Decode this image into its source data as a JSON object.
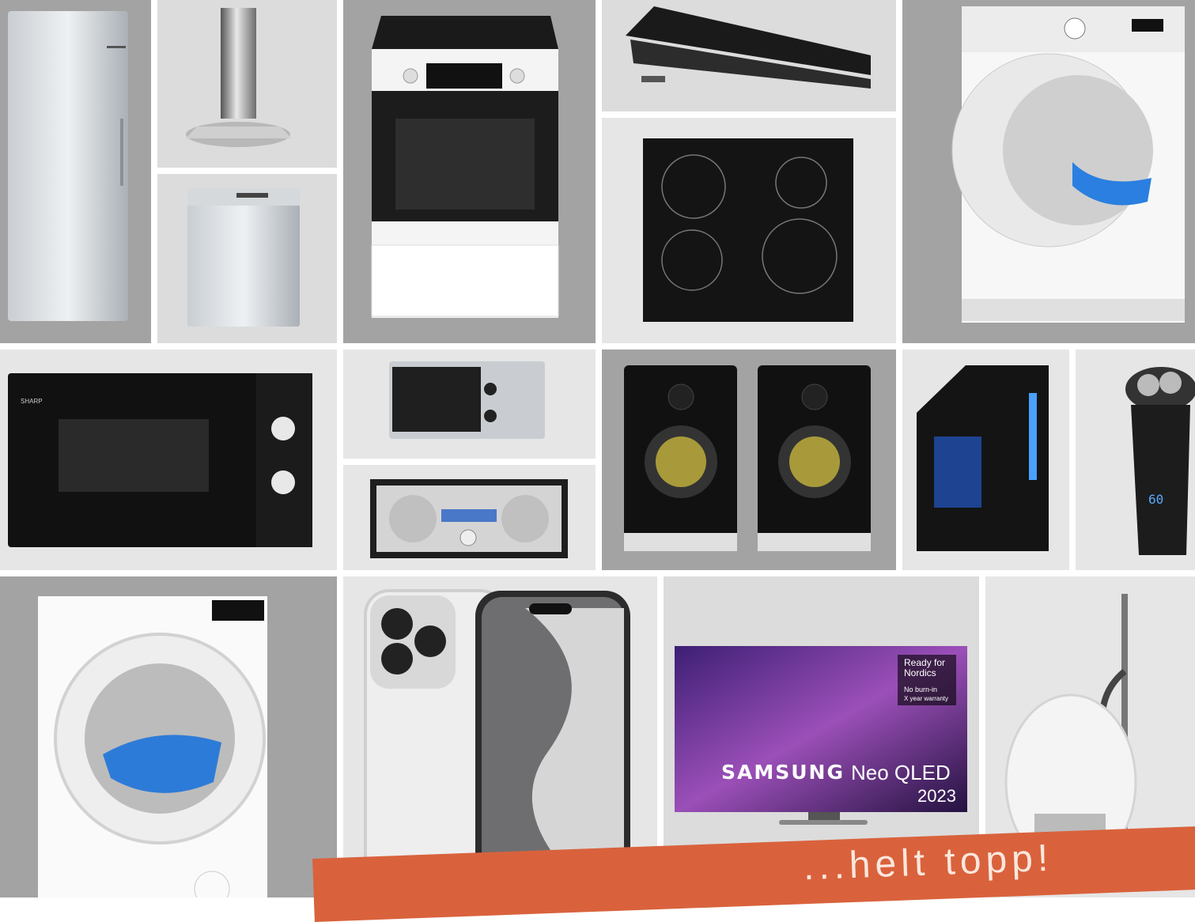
{
  "products": [
    {
      "id": "fridge",
      "label": ""
    },
    {
      "id": "range-hood",
      "label": ""
    },
    {
      "id": "dishwasher",
      "label": ""
    },
    {
      "id": "electric-cooker",
      "label": ""
    },
    {
      "id": "slide-out-hood",
      "label": ""
    },
    {
      "id": "induction-hob",
      "label": ""
    },
    {
      "id": "tumble-dryer",
      "label": ""
    },
    {
      "id": "microwave-large",
      "label": ""
    },
    {
      "id": "microwave-small",
      "label": ""
    },
    {
      "id": "radio-cd",
      "label": ""
    },
    {
      "id": "speakers",
      "label": ""
    },
    {
      "id": "gaming-pc",
      "label": ""
    },
    {
      "id": "shaver",
      "label": ""
    },
    {
      "id": "washing-machine",
      "label": ""
    },
    {
      "id": "smartphone",
      "label": ""
    },
    {
      "id": "tv",
      "label": ""
    },
    {
      "id": "vacuum",
      "label": ""
    }
  ],
  "tv": {
    "brand": "SAMSUNG",
    "model": "Neo QLED",
    "year": "2023",
    "badge_line1": "Ready for",
    "badge_line2": "Nordics",
    "badge_line3": "No burn-in",
    "badge_line4": "X year warranty"
  },
  "shaver_display": "60",
  "banner_text": "...helt topp!",
  "colors": {
    "banner": "#d9623c",
    "dark_tile": "#a3a3a3",
    "light_tile": "#e6e6e6"
  }
}
